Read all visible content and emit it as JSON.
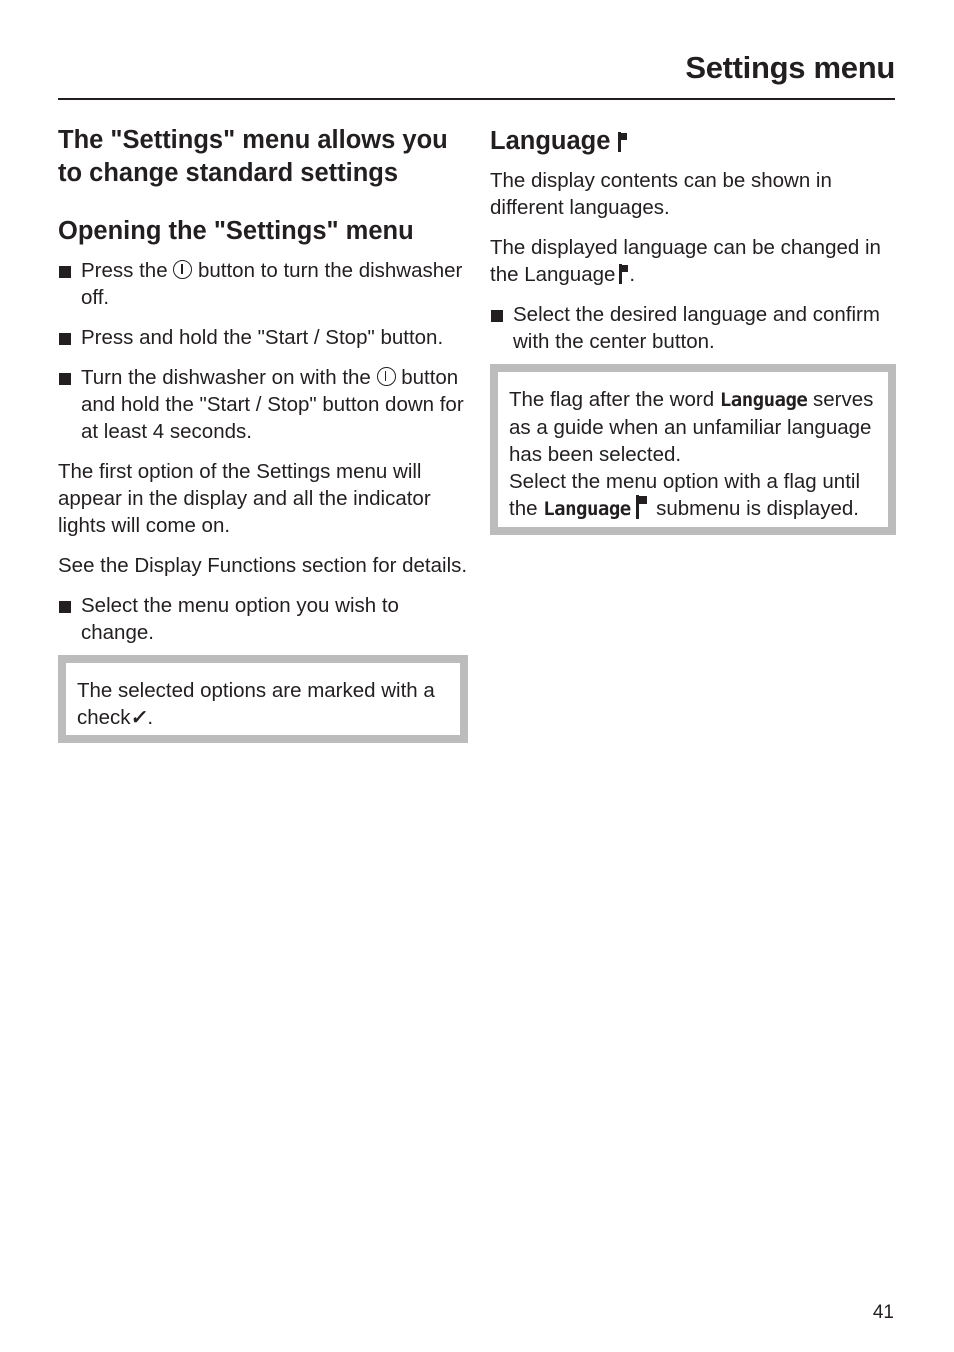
{
  "header": {
    "title": "Settings menu"
  },
  "left": {
    "main_heading": "The \"Settings\" menu allows you to change standard settings",
    "sub_heading": "Opening the \"Settings\" menu",
    "bullets1": [
      {
        "before": "Press the ",
        "icon": "power-icon",
        "after": " button to turn the dishwasher off."
      },
      {
        "text": "Press and hold the \"Start / Stop\" button."
      },
      {
        "before": "Turn the dishwasher on with the ",
        "icon": "power-icon",
        "after": " button and hold the \"Start / Stop\" button down for at least 4 seconds."
      }
    ],
    "para1": "The first option of the Settings menu will appear in the display and all the indicator lights will come on.",
    "para2": "See the Display Functions section for details.",
    "bullet2": "Select the menu option you wish to change.",
    "note": {
      "text": "The selected options are marked with a  check",
      "icon": "check-icon",
      "check_glyph": "✓",
      "suffix": "."
    }
  },
  "right": {
    "heading": "Language",
    "heading_icon": "flag-icon",
    "para1": "The display contents can be shown in different languages.",
    "para2": "The displayed language can be changed in the Language",
    "para2_suffix": ".",
    "bullet": "Select the desired language and confirm with the center button.",
    "note": {
      "line1_before": "The flag after the word ",
      "line1_lcd": "Language",
      "line1_after": " serves as a guide when an unfamiliar language has been selected.",
      "line2_before": "Select the menu option with a flag until the ",
      "line2_lcd": "Language",
      "line2_after": " submenu is displayed."
    }
  },
  "footer": {
    "page_number": "41"
  }
}
